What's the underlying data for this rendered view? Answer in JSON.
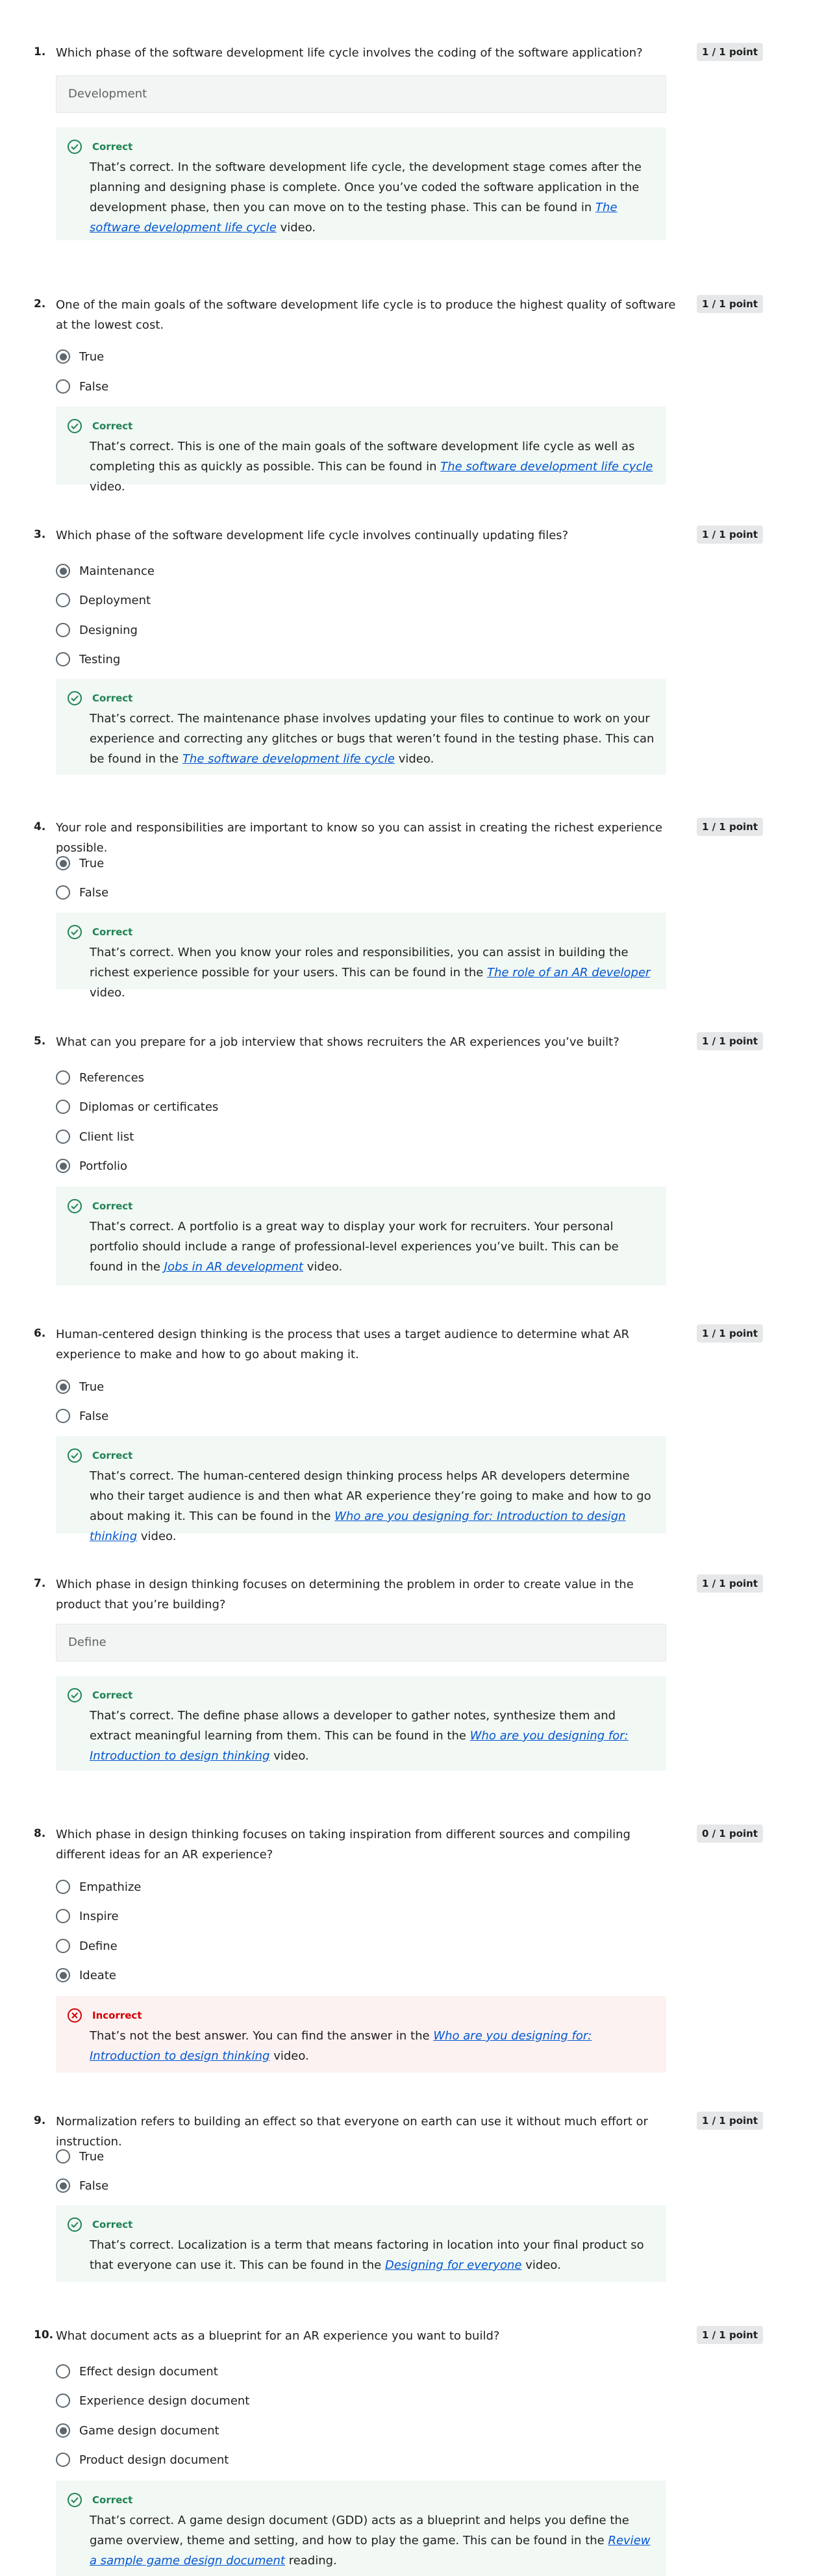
{
  "quiz": {
    "questions": [
      {
        "number": "1.",
        "text": "Which phase of the software development life cycle involves the coding of the software application?",
        "points": "1 / 1 point",
        "answer": "Development",
        "feedback": {
          "status": "Correct",
          "pre": "That’s correct. In the software development life cycle, the development stage comes after the planning and designing phase is complete. Once you’ve coded the software application in the development phase, then you can move on to the testing phase. This can be found in ",
          "link": "The software development life cycle",
          "post": " video."
        }
      },
      {
        "number": "2.",
        "text": "One of the main goals of the software development life cycle is to produce the highest quality of software at the lowest cost.",
        "points": "1 / 1 point",
        "options": [
          "True",
          "False"
        ],
        "selected": 0,
        "feedback": {
          "status": "Correct",
          "pre": "That’s correct. This is one of the main goals of the software development life cycle as well as completing this as quickly as possible. This can be found in ",
          "link": "The software development life cycle",
          "post": " video."
        }
      },
      {
        "number": "3.",
        "text": "Which phase of the software development life cycle involves continually updating files?",
        "points": "1 / 1 point",
        "options": [
          "Maintenance",
          "Deployment",
          "Designing",
          "Testing"
        ],
        "selected": 0,
        "feedback": {
          "status": "Correct",
          "pre": "That’s correct. The maintenance phase involves updating your files to continue to work on your experience and correcting any glitches or bugs that weren’t found in the testing phase. This can be found in the ",
          "link": "The software development life cycle",
          "post": " video."
        }
      },
      {
        "number": "4.",
        "text": "Your role and responsibilities are important to know so you can assist in creating the richest experience possible.",
        "points": "1 / 1 point",
        "options": [
          "True",
          "False"
        ],
        "selected": 0,
        "feedback": {
          "status": "Correct",
          "pre": "That’s correct. When you know your roles and responsibilities, you can assist in building the richest experience possible for your users. This can be found in the ",
          "link": "The role of an AR developer",
          "post": " video."
        }
      },
      {
        "number": "5.",
        "text": "What can you prepare for a job interview that shows recruiters the AR experiences you’ve built?",
        "points": "1 / 1 point",
        "options": [
          "References",
          "Diplomas or certificates",
          "Client list",
          "Portfolio"
        ],
        "selected": 3,
        "feedback": {
          "status": "Correct",
          "pre": "That’s correct. A portfolio is a great way to display your work for recruiters. Your personal portfolio should include a range of professional-level experiences you’ve built. This can be found in the ",
          "link": "Jobs in AR development",
          "post": " video."
        }
      },
      {
        "number": "6.",
        "text": "Human-centered design thinking is the process that uses a target audience to determine what AR experience to make and how to go about making it.",
        "points": "1 / 1 point",
        "options": [
          "True",
          "False"
        ],
        "selected": 0,
        "feedback": {
          "status": "Correct",
          "pre": "That’s correct. The human-centered design thinking process helps AR developers determine who their target audience is and then what AR experience they’re going to make and how to go about making it. This can be found in the ",
          "link": "Who are you designing for: Introduction to design thinking",
          "post": " video."
        }
      },
      {
        "number": "7.",
        "text": "Which phase in design thinking focuses on determining the problem in order to create value in the product that you’re building?",
        "points": "1 / 1 point",
        "answer": "Define",
        "feedback": {
          "status": "Correct",
          "pre": "That’s correct. The define phase allows a developer to gather notes, synthesize them and extract meaningful learning from them. This can be found in the ",
          "link": "Who are you designing for: Introduction to design thinking",
          "post": " video."
        }
      },
      {
        "number": "8.",
        "text": "Which phase in design thinking focuses on taking inspiration from different sources and compiling different ideas for an AR experience?",
        "points": "0 / 1 point",
        "options": [
          "Empathize",
          "Inspire",
          "Define",
          "Ideate"
        ],
        "selected": 3,
        "feedback": {
          "status": "Incorrect",
          "pre": "That’s not the best answer. You can find the answer in the ",
          "link": "Who are you designing for: Introduction to design thinking",
          "post": " video."
        }
      },
      {
        "number": "9.",
        "text": "Normalization refers to building an effect so that everyone on earth can use it without much effort or instruction.",
        "points": "1 / 1 point",
        "options": [
          "True",
          "False"
        ],
        "selected": 1,
        "feedback": {
          "status": "Correct",
          "pre": "That’s correct. Localization is a term that means factoring in location into your final product so that everyone can use it. This can be found in the ",
          "link": "Designing for everyone",
          "post": " video."
        }
      },
      {
        "number": "10.",
        "text": "What document acts as a blueprint for an AR experience you want to build?",
        "points": "1 / 1 point",
        "options": [
          "Effect design document",
          "Experience design document",
          "Game design document",
          "Product design document"
        ],
        "selected": 2,
        "feedback": {
          "status": "Correct",
          "pre": "That’s correct. A game design document (GDD) acts as a blueprint and helps you define the game overview, theme and setting, and how to play the game. This can be found in the ",
          "link": "Review a sample game design document",
          "post": " reading."
        }
      }
    ]
  }
}
